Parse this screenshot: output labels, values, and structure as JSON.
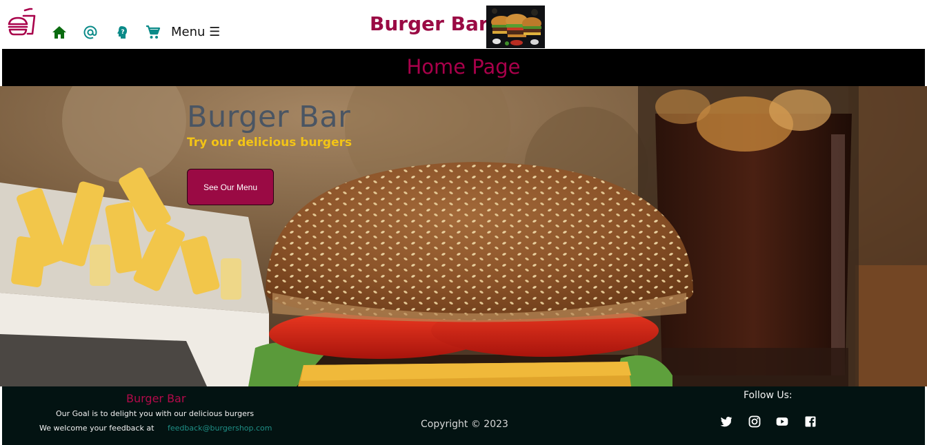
{
  "nav": {
    "menu_label": "Menu ☰",
    "brand": "Burger Bar",
    "icons": [
      "logo-burger-drink",
      "home-icon",
      "at-icon",
      "question-icon",
      "cart-icon",
      "hamburger-menu-icon"
    ]
  },
  "banner": {
    "title": "Home Page"
  },
  "hero": {
    "title": "Burger Bar",
    "subtitle": "Try our delicious burgers",
    "button_label": "See Our Menu"
  },
  "footer": {
    "brand": "Burger Bar",
    "goal": "Our Goal is to delight you with our delicious burgers",
    "feedback_label": "We welcome your feedback at",
    "email": "feedback@burgershop.com",
    "copyright": "Copyright © 2023",
    "follow_label": "Follow Us:",
    "social": [
      "twitter-icon",
      "instagram-icon",
      "youtube-icon",
      "facebook-icon"
    ]
  },
  "colors": {
    "brand": "#9a0a44",
    "nav_icon": "#0a8a88",
    "home_icon": "#0a6b10",
    "banner_bg": "#000000",
    "hero_subtitle": "#f3c416",
    "footer_bg": "#031312",
    "email_link": "#1f8f86"
  }
}
